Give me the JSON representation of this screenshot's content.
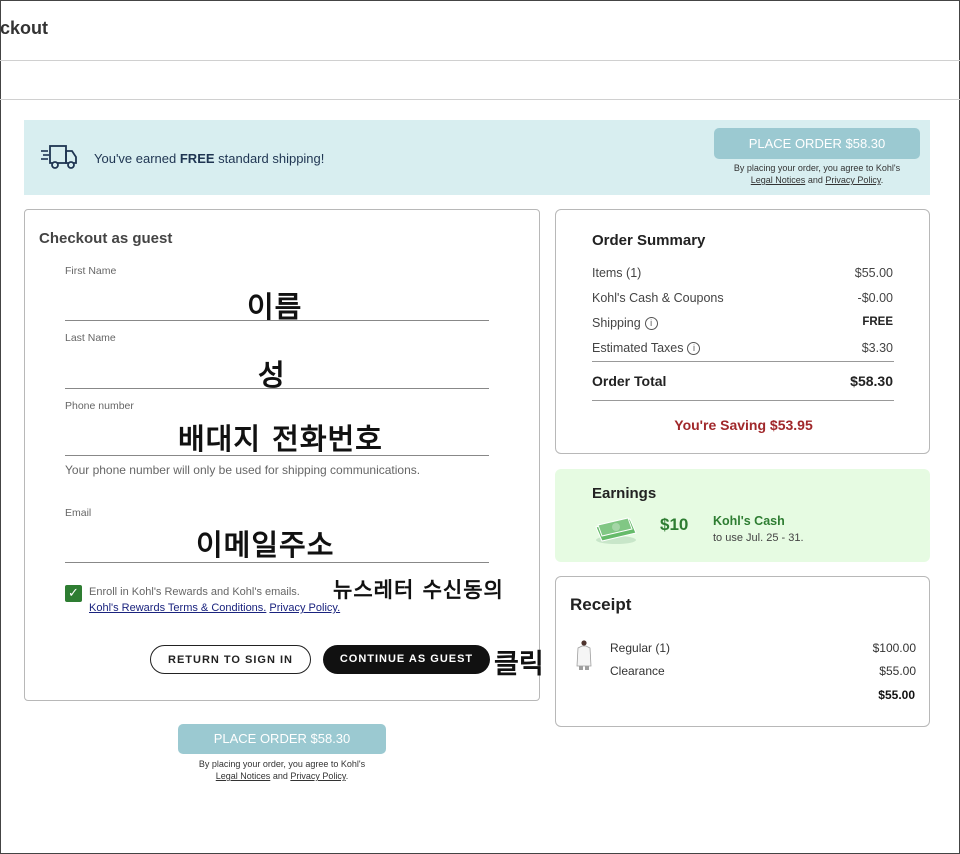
{
  "header": {
    "title": "ckout"
  },
  "banner": {
    "message_prefix": "You've earned ",
    "message_bold": "FREE",
    "message_suffix": " standard shipping!",
    "place_order_label": "PLACE ORDER $58.30",
    "note_line1": "By placing your order, you agree to Kohl's",
    "legal_link": "Legal Notices",
    "and_text": "and",
    "privacy_link": "Privacy Policy",
    "period": "."
  },
  "guest": {
    "title": "Checkout as guest",
    "first_name_label": "First Name",
    "first_name_annotation": "이름",
    "last_name_label": "Last Name",
    "last_name_annotation": "성",
    "phone_label": "Phone number",
    "phone_annotation": "배대지 전화번호",
    "phone_hint": "Your phone number will only be used for shipping communications.",
    "email_label": "Email",
    "email_annotation": "이메일주소",
    "enroll_text": "Enroll in Kohl's Rewards and Kohl's emails.",
    "enroll_annotation": "뉴스레터 수신동의",
    "rewards_terms_link": "Kohl's Rewards Terms & Conditions.",
    "privacy_link": "Privacy Policy.",
    "return_button": "RETURN TO SIGN IN",
    "continue_button": "CONTINUE AS GUEST",
    "click_annotation": "클릭"
  },
  "bottom_place_order": {
    "label": "PLACE ORDER $58.30",
    "note_line1": "By placing your order, you agree to Kohl's",
    "legal_link": "Legal Notices",
    "and_text": "and",
    "privacy_link": "Privacy Policy",
    "period": "."
  },
  "summary": {
    "title": "Order Summary",
    "items_label": "Items (1)",
    "items_value": "$55.00",
    "cash_label": "Kohl's Cash & Coupons",
    "cash_value": "-$0.00",
    "shipping_label": "Shipping",
    "shipping_value": "FREE",
    "taxes_label": "Estimated Taxes",
    "taxes_value": "$3.30",
    "total_label": "Order Total",
    "total_value": "$58.30",
    "saving": "You're Saving $53.95"
  },
  "earnings": {
    "title": "Earnings",
    "amount": "$10",
    "label": "Kohl's Cash",
    "sub": "to use Jul. 25 - 31."
  },
  "receipt": {
    "title": "Receipt",
    "regular_label": "Regular (1)",
    "regular_value": "$100.00",
    "clearance_label": "Clearance",
    "clearance_value": "$55.00",
    "total_value": "$55.00"
  },
  "colors": {
    "banner_bg": "#d8eef0",
    "place_order_bg": "#9bc9d1",
    "earnings_bg": "#e6fbe2",
    "kohls_green": "#2e7d32",
    "saving_red": "#a0282b"
  }
}
